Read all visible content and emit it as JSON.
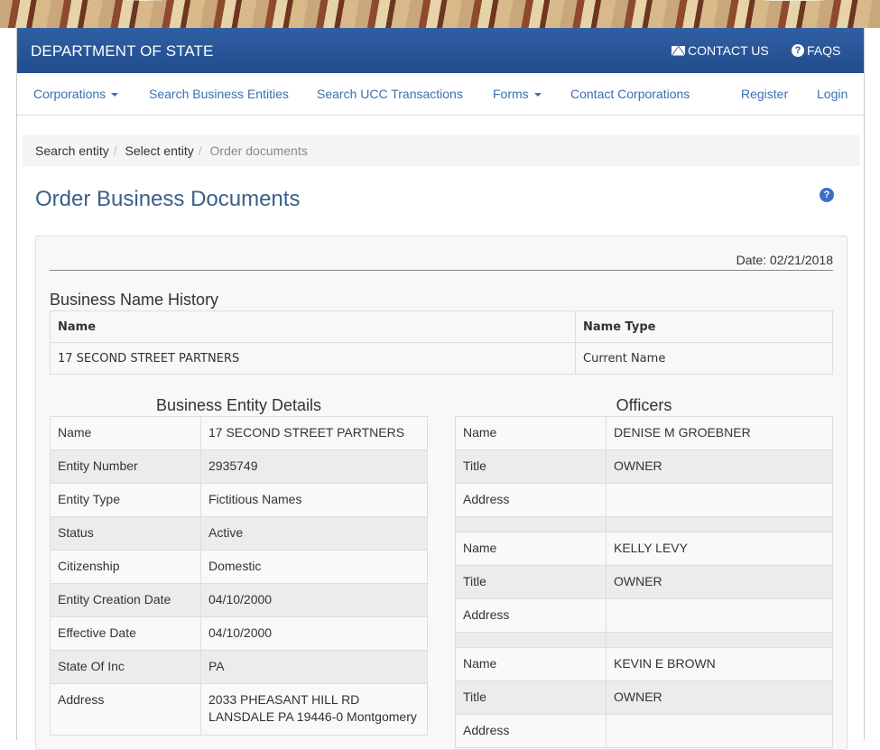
{
  "header": {
    "brand": "DEPARTMENT OF STATE",
    "contact_label": "CONTACT US",
    "faqs_label": "FAQS"
  },
  "nav": {
    "items": [
      {
        "label": "Corporations",
        "dropdown": true
      },
      {
        "label": "Search Business Entities",
        "dropdown": false
      },
      {
        "label": "Search UCC Transactions",
        "dropdown": false
      },
      {
        "label": "Forms",
        "dropdown": true
      },
      {
        "label": "Contact Corporations",
        "dropdown": false
      }
    ],
    "register": "Register",
    "login": "Login"
  },
  "breadcrumb": {
    "items": [
      "Search entity",
      "Select entity",
      "Order documents"
    ]
  },
  "page": {
    "title": "Order Business Documents",
    "help_glyph": "?"
  },
  "date_line": "Date: 02/21/2018",
  "history": {
    "title": "Business Name History",
    "headers": [
      "Name",
      "Name Type"
    ],
    "rows": [
      [
        "17 SECOND STREET PARTNERS",
        "Current Name"
      ]
    ]
  },
  "details": {
    "title": "Business Entity Details",
    "rows": [
      [
        "Name",
        "17 SECOND STREET PARTNERS"
      ],
      [
        "Entity Number",
        "2935749"
      ],
      [
        "Entity Type",
        "Fictitious Names"
      ],
      [
        "Status",
        "Active"
      ],
      [
        "Citizenship",
        "Domestic"
      ],
      [
        "Entity Creation Date",
        "04/10/2000"
      ],
      [
        "Effective Date",
        "04/10/2000"
      ],
      [
        "State Of Inc",
        "PA"
      ]
    ],
    "address_label": "Address",
    "address_line1": "2033 PHEASANT HILL RD",
    "address_line2": "LANSDALE PA 19446-0 Montgomery"
  },
  "officers": {
    "title": "Officers",
    "people": [
      {
        "name_label": "Name",
        "name": "DENISE M GROEBNER",
        "title_label": "Title",
        "title": "OWNER",
        "address_label": "Address",
        "address": ""
      },
      {
        "name_label": "Name",
        "name": "KELLY LEVY",
        "title_label": "Title",
        "title": "OWNER",
        "address_label": "Address",
        "address": ""
      },
      {
        "name_label": "Name",
        "name": "KEVIN E BROWN",
        "title_label": "Title",
        "title": "OWNER",
        "address_label": "Address",
        "address": ""
      }
    ]
  },
  "colors": {
    "header_blue": "#224d8e",
    "link_blue": "#3a6fb0",
    "title_blue": "#3c5e8a"
  }
}
